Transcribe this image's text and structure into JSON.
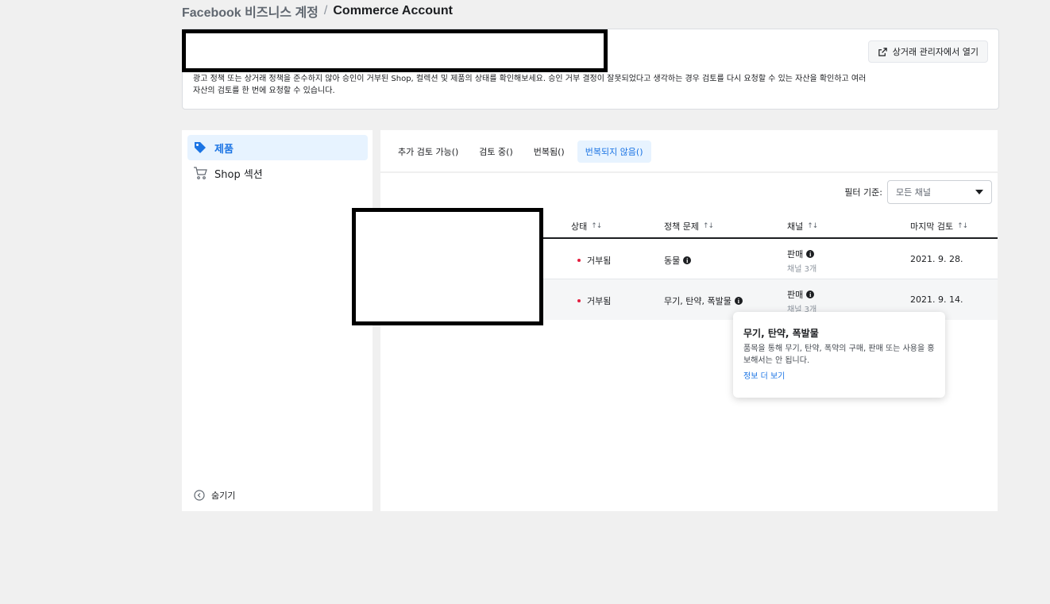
{
  "breadcrumb": {
    "parent": "Facebook 비즈니스 계정",
    "separator": "/",
    "current": "Commerce Account"
  },
  "header": {
    "description": "광고 정책 또는 상거래 정책을 준수하지 않아 승인이 거부된 Shop, 컬렉션 및 제품의 상태를 확인해보세요. 승인 거부 결정이 잘못되었다고 생각하는 경우 검토를 다시 요청할 수 있는 자산을 확인하고 여러 자산의 검토를 한 번에 요청할 수 있습니다.",
    "open_button": "상거래 관리자에서 열기"
  },
  "sidebar": {
    "items": [
      {
        "label": "제품",
        "icon": "tag-icon",
        "active": true
      },
      {
        "label": "Shop 섹션",
        "icon": "cart-icon",
        "active": false
      }
    ],
    "hide_label": "숨기기"
  },
  "tabs": [
    {
      "label": "추가 검토 가능()",
      "active": false
    },
    {
      "label": "검토 중()",
      "active": false
    },
    {
      "label": "번복됨()",
      "active": false
    },
    {
      "label": "번복되지 않음()",
      "active": true
    }
  ],
  "filter": {
    "label": "필터 기준:",
    "value": "모든 채널"
  },
  "table": {
    "columns": [
      "상태",
      "정책 문제",
      "채널",
      "마지막 검토"
    ],
    "rows": [
      {
        "status": "거부됨",
        "policy": "동물",
        "channel": "판매",
        "channel_sub": "채널 3개",
        "date": "2021. 9. 28."
      },
      {
        "status": "거부됨",
        "policy": "무기, 탄약, 폭발물",
        "channel": "판매",
        "channel_sub": "채널 3개",
        "date": "2021. 9. 14."
      }
    ]
  },
  "tooltip": {
    "title": "무기, 탄약, 폭발물",
    "body": "품목을 통해 무기, 탄약, 폭약의 구매, 판매 또는 사용을 홍보해서는 안 됩니다.",
    "link": "정보 더 보기"
  },
  "colors": {
    "accent": "#1b74e4",
    "accent_bg": "#e7f3ff",
    "status_red": "#e41e3f"
  }
}
